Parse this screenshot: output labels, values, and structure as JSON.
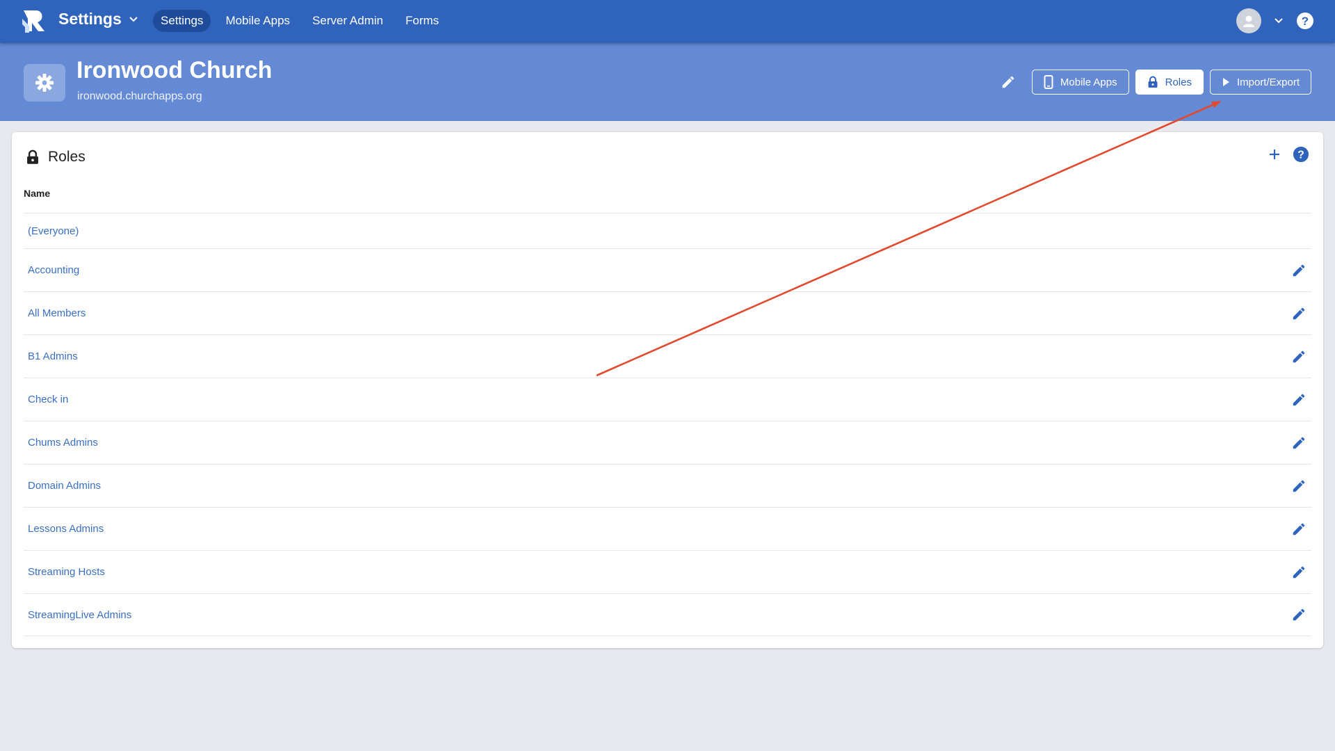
{
  "app": {
    "title": "Settings"
  },
  "nav": {
    "items": [
      {
        "label": "Settings",
        "active": true
      },
      {
        "label": "Mobile Apps",
        "active": false
      },
      {
        "label": "Server Admin",
        "active": false
      },
      {
        "label": "Forms",
        "active": false
      }
    ]
  },
  "header": {
    "church_name": "Ironwood Church",
    "church_url": "ironwood.churchapps.org",
    "buttons": {
      "mobile_apps": "Mobile Apps",
      "roles": "Roles",
      "import_export": "Import/Export"
    }
  },
  "roles_card": {
    "title": "Roles",
    "column_name": "Name",
    "rows": [
      {
        "name": "(Everyone)",
        "editable": false
      },
      {
        "name": "Accounting",
        "editable": true
      },
      {
        "name": "All Members",
        "editable": true
      },
      {
        "name": "B1 Admins",
        "editable": true
      },
      {
        "name": "Check in",
        "editable": true
      },
      {
        "name": "Chums Admins",
        "editable": true
      },
      {
        "name": "Domain Admins",
        "editable": true
      },
      {
        "name": "Lessons Admins",
        "editable": true
      },
      {
        "name": "Streaming Hosts",
        "editable": true
      },
      {
        "name": "StreamingLive Admins",
        "editable": true
      }
    ]
  },
  "colors": {
    "nav": "#2f63bc",
    "header": "#648ad5",
    "accent": "#2f63bc",
    "link": "#3a6fc4",
    "arrow": "#e04a2e"
  }
}
